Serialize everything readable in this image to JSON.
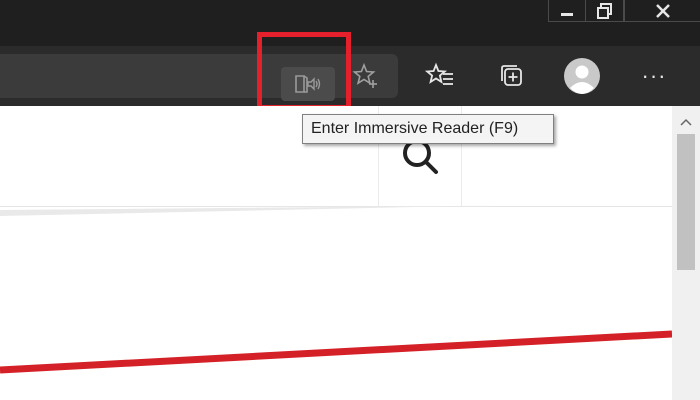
{
  "window": {
    "minimize_glyph": "—",
    "maximize_glyph": "",
    "close_glyph": "✕"
  },
  "toolbar": {
    "immersive_reader_icon": "immersive-reader-icon",
    "favorites_add_icon": "star-add-icon",
    "favorites_icon": "favorites-list-icon",
    "collections_icon": "collections-icon",
    "profile_icon": "avatar",
    "more_label": "···"
  },
  "tooltip": {
    "text": "Enter Immersive Reader (F9)"
  },
  "colors": {
    "titlebar": "#1f1f1f",
    "toolbar": "#2b2b2b",
    "highlight": "#e5202d",
    "accent_line": "#d42027"
  }
}
